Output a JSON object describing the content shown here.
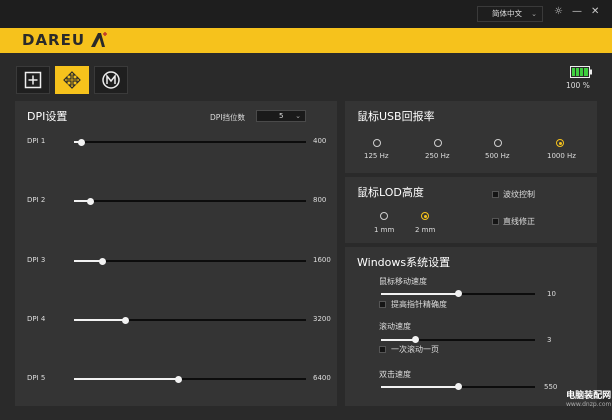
{
  "header": {
    "language": "简体中文",
    "brand": "DAREU",
    "colors": {
      "accent": "#f6c21c",
      "background": "#2a2a2a",
      "panel": "#343434"
    }
  },
  "modes": [
    {
      "name": "plus-square-icon",
      "active": false
    },
    {
      "name": "move-arrows-icon",
      "active": true
    },
    {
      "name": "m-circle-icon",
      "active": false
    }
  ],
  "battery": {
    "percent_label": "100 %",
    "level": 1.0
  },
  "dpi": {
    "title": "DPI设置",
    "level_label": "DPI挡位数",
    "level_value": "5",
    "rows": [
      {
        "label": "DPI 1",
        "value": "400",
        "fraction": 0.03
      },
      {
        "label": "DPI 2",
        "value": "800",
        "fraction": 0.07
      },
      {
        "label": "DPI 3",
        "value": "1600",
        "fraction": 0.12
      },
      {
        "label": "DPI 4",
        "value": "3200",
        "fraction": 0.22
      },
      {
        "label": "DPI 5",
        "value": "6400",
        "fraction": 0.45
      }
    ]
  },
  "polling": {
    "title": "鼠标USB回报率",
    "options": [
      {
        "label": "125 Hz",
        "checked": false
      },
      {
        "label": "250 Hz",
        "checked": false
      },
      {
        "label": "500 Hz",
        "checked": false
      },
      {
        "label": "1000 Hz",
        "checked": true
      }
    ]
  },
  "lod": {
    "title": "鼠标LOD高度",
    "options": [
      {
        "label": "1 mm",
        "checked": false
      },
      {
        "label": "2 mm",
        "checked": true
      }
    ],
    "ripple_label": "波纹控制",
    "angle_label": "直线修正"
  },
  "windows": {
    "title": "Windows系统设置",
    "speed_label": "鼠标移动速度",
    "speed_value": "10",
    "speed_fraction": 0.5,
    "precision_label": "提高指针精确度",
    "scroll_label": "滚动速度",
    "scroll_value": "3",
    "scroll_fraction": 0.22,
    "scroll_page_label": "一次滚动一页",
    "dblclick_label": "双击速度",
    "dblclick_value": "550",
    "dblclick_fraction": 0.5
  },
  "watermark": {
    "main": "电脑装配网",
    "sub": "www.dnzp.com"
  }
}
